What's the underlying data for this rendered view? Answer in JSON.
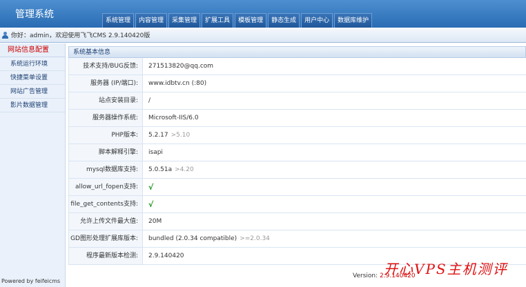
{
  "app": {
    "title": "管理系统"
  },
  "nav": [
    "系统管理",
    "内容管理",
    "采集管理",
    "扩展工具",
    "模板管理",
    "静态生成",
    "用户中心",
    "数据库维护"
  ],
  "greeting": "你好：admin，欢迎使用飞飞CMS 2.9.140420版",
  "sidebar": {
    "header": "网站信息配置",
    "items": [
      "系统运行环境",
      "快捷菜单设置",
      "网站广告管理",
      "影片数据管理"
    ],
    "powered": "Powered by feifeicms"
  },
  "panel": {
    "title": "系统基本信息",
    "rows": [
      {
        "label": "技术支持/BUG反馈:",
        "value": "271513820@qq.com",
        "hint": ""
      },
      {
        "label": "服务器 (IP/端口):",
        "value": "www.idbtv.cn (:80)",
        "hint": ""
      },
      {
        "label": "站点安装目录:",
        "value": "/",
        "hint": ""
      },
      {
        "label": "服务器操作系统:",
        "value": "Microsoft-IIS/6.0",
        "hint": ""
      },
      {
        "label": "PHP版本:",
        "value": "5.2.17",
        "hint": ">5.10"
      },
      {
        "label": "脚本解释引擎:",
        "value": "isapi",
        "hint": ""
      },
      {
        "label": "mysql数据库支持:",
        "value": "5.0.51a",
        "hint": ">4.20"
      },
      {
        "label": "allow_url_fopen支持:",
        "value": "√",
        "hint": ""
      },
      {
        "label": "file_get_contents支持:",
        "value": "√",
        "hint": ""
      },
      {
        "label": "允许上传文件最大值:",
        "value": "20M",
        "hint": ""
      },
      {
        "label": "GD图形处理扩展库版本:",
        "value": "bundled (2.0.34 compatible)",
        "hint": ">=2.0.34"
      },
      {
        "label": "程序最新版本检测:",
        "value": "2.9.140420",
        "hint": ""
      }
    ]
  },
  "footer": {
    "version_label": "Version:",
    "version": "2.9.140420"
  },
  "watermark": "开心VPS主机测评",
  "colors": {
    "header": "#2a6cb3",
    "accent": "#cc0000",
    "check": "#0a8a0a"
  }
}
